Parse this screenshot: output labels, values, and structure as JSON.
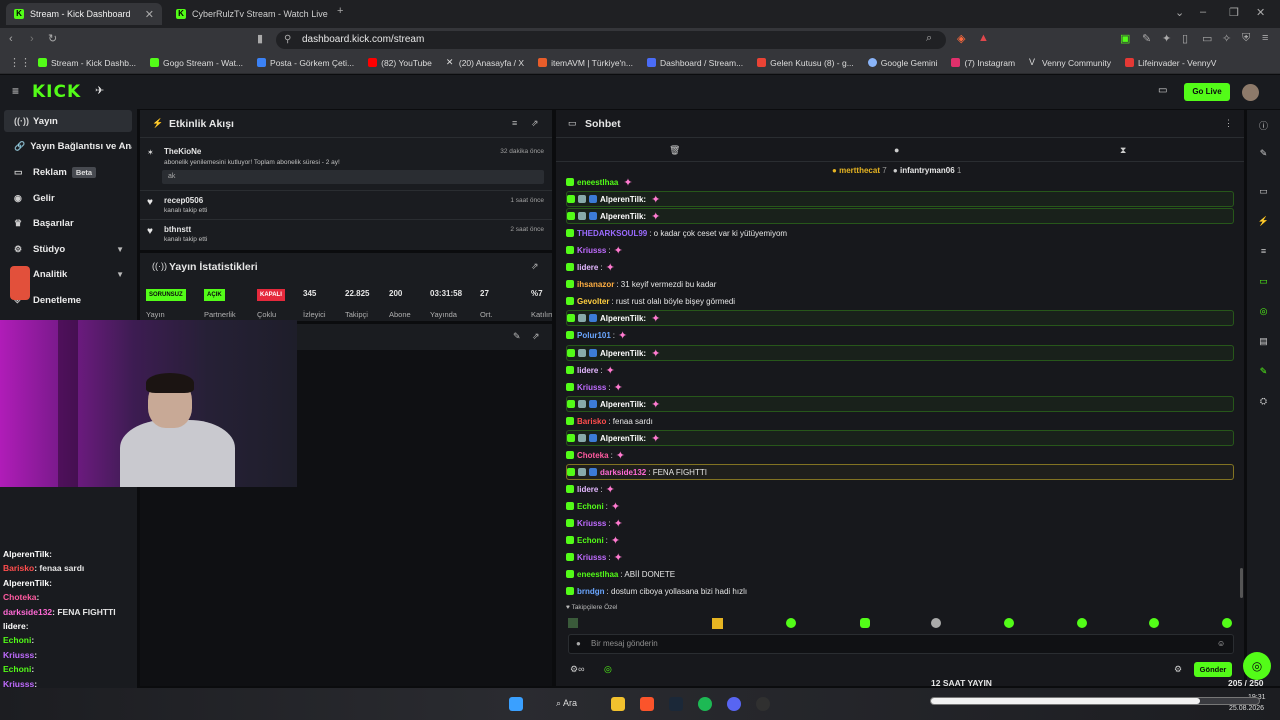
{
  "browser": {
    "tabs": [
      {
        "title": "Stream - Kick Dashboard"
      },
      {
        "title": "CyberRulzTv Stream - Watch Live on"
      }
    ],
    "new_tab": "+",
    "url": "dashboard.kick.com/stream",
    "bookmarks": [
      {
        "label": "Stream - Kick Dashb...",
        "color": "#53fc18"
      },
      {
        "label": "Gogo Stream - Wat...",
        "color": "#53fc18"
      },
      {
        "label": "Posta - Görkem Çeti...",
        "color": "#3b82f6"
      },
      {
        "label": "(82) YouTube",
        "color": "#ff0000"
      },
      {
        "label": "(20) Anasayfa / X",
        "color": "#dddddd"
      },
      {
        "label": "itemAVM | Türkiye'n...",
        "color": "#e85d2a"
      },
      {
        "label": "Dashboard / Stream...",
        "color": "#4a6cf7"
      },
      {
        "label": "Gelen Kutusu (8) - g...",
        "color": "#ea4335"
      },
      {
        "label": "Google Gemini",
        "color": "#8ab4f8"
      },
      {
        "label": "(7) Instagram",
        "color": "#e1306c"
      },
      {
        "label": "Venny Community",
        "color": "#dddddd"
      },
      {
        "label": "Lifeinvader - VennyV",
        "color": "#e53935"
      }
    ]
  },
  "kick": {
    "logo": "KICK",
    "go_live": "Go Live"
  },
  "sidebar": {
    "items": [
      {
        "label": "Yayın",
        "icon": "broadcast-icon"
      },
      {
        "label": "Yayın Bağlantısı ve Anahtarı",
        "icon": "link-icon"
      },
      {
        "label": "Reklam",
        "badge": "Beta",
        "icon": "ad-icon"
      },
      {
        "label": "Gelir",
        "icon": "revenue-icon"
      },
      {
        "label": "Başarılar",
        "icon": "trophy-icon"
      },
      {
        "label": "Stüdyo",
        "icon": "studio-icon"
      },
      {
        "label": "Analitik",
        "icon": "analytics-icon"
      },
      {
        "label": "Denetleme",
        "icon": "moderation-icon"
      }
    ]
  },
  "activity": {
    "title": "Etkinlik Akışı",
    "events": [
      {
        "name": "TheKioNe",
        "desc": "abonelik yenilemesini kutluyor! Toplam abonelik süresi - 2 ay!",
        "time": "32 dakika önce",
        "quote": "ak"
      },
      {
        "name": "recep0506",
        "desc": "kanalı takip etti",
        "time": "1 saat önce"
      },
      {
        "name": "bthnstt",
        "desc": "kanalı takip etti",
        "time": "2 saat önce"
      }
    ]
  },
  "stats": {
    "title": "Yayın İstatistikleri",
    "badges": [
      {
        "text": "SORUNSUZ",
        "label": "Yayın",
        "color": "#53fc18"
      },
      {
        "text": "AÇIK",
        "label": "Partnerlik",
        "color": "#53fc18"
      },
      {
        "text": "KAPALI",
        "label": "Çoklu",
        "color": "#e5293c"
      }
    ],
    "values": [
      {
        "value": "345",
        "label": "İzleyici"
      },
      {
        "value": "22.825",
        "label": "Takipçi"
      },
      {
        "value": "200",
        "label": "Abone Sayısı"
      },
      {
        "value": "03:31:58",
        "label": "Yayında Olduğu"
      },
      {
        "value": "27",
        "label": "Ort. Sohbet"
      },
      {
        "value": "%7",
        "label": "Katılım"
      }
    ]
  },
  "chat": {
    "title": "Sohbet",
    "pinned": [
      {
        "name": "mertthecat",
        "count": "7"
      },
      {
        "name": "infantryman06",
        "count": "1"
      }
    ],
    "messages": [
      {
        "user": "eneestlhaa",
        "text": "",
        "color": "#53fc18",
        "hl": false
      },
      {
        "user": "AlperenTilk:",
        "text": "",
        "color": "#ffffff",
        "hl": true
      },
      {
        "user": "AlperenTilk:",
        "text": "",
        "color": "#ffffff",
        "hl": true
      },
      {
        "user": "THEDARKSOUL99",
        "text": ": o kadar çok ceset var ki yütüyemiyom",
        "color": "#9b6bff",
        "hl": false
      },
      {
        "user": "Kriusss",
        "text": ":",
        "color": "#c06bff",
        "hl": false
      },
      {
        "user": "lidere",
        "text": ":",
        "color": "#e3b7ff",
        "hl": false
      },
      {
        "user": "ihsanazor",
        "text": ": 31 keyif vermezdi bu kadar",
        "color": "#ffae42",
        "hl": false
      },
      {
        "user": "Gevolter",
        "text": ": rust rust olalı böyle bişey görmedi",
        "color": "#ffcf40",
        "hl": false
      },
      {
        "user": "AlperenTilk:",
        "text": "",
        "color": "#ffffff",
        "hl": true
      },
      {
        "user": "Polur101",
        "text": ":",
        "color": "#6aa6ff",
        "hl": false
      },
      {
        "user": "AlperenTilk:",
        "text": "",
        "color": "#ffffff",
        "hl": true
      },
      {
        "user": "lidere",
        "text": ":",
        "color": "#e3b7ff",
        "hl": false
      },
      {
        "user": "Kriusss",
        "text": ":",
        "color": "#c06bff",
        "hl": false
      },
      {
        "user": "AlperenTilk:",
        "text": "",
        "color": "#ffffff",
        "hl": true
      },
      {
        "user": "Barisko",
        "text": ": fenaa sardı",
        "color": "#ff4d4d",
        "hl": false
      },
      {
        "user": "AlperenTilk:",
        "text": "",
        "color": "#ffffff",
        "hl": true
      },
      {
        "user": "Choteka",
        "text": ":",
        "color": "#ff5aa0",
        "hl": false
      },
      {
        "user": "darkside132",
        "text": ": FENA FIGHTTI",
        "color": "#ff6ad5",
        "hl": "y"
      },
      {
        "user": "lidere",
        "text": ":",
        "color": "#e3b7ff",
        "hl": false
      },
      {
        "user": "Echoni",
        "text": ":",
        "color": "#53fc18",
        "hl": false
      },
      {
        "user": "Kriusss",
        "text": ":",
        "color": "#c06bff",
        "hl": false
      },
      {
        "user": "Echoni",
        "text": ":",
        "color": "#53fc18",
        "hl": false
      },
      {
        "user": "Kriusss",
        "text": ":",
        "color": "#c06bff",
        "hl": false
      },
      {
        "user": "eneestlhaa",
        "text": ": ABİİ DONETE",
        "color": "#53fc18",
        "hl": false
      },
      {
        "user": "brndgn",
        "text": ": dostum ciboya yollasana bizi hadi hızlı",
        "color": "#6aa6ff",
        "hl": false
      }
    ],
    "followers_only": "Takipçilere Özel",
    "placeholder": "Bir mesaj gönderin",
    "send": "Gönder"
  },
  "overlay_chat": [
    {
      "user": "AlperenTilk",
      "text": ":",
      "color": "#ffffff"
    },
    {
      "user": "Barisko",
      "text": ": fenaa sardı",
      "color": "#ff4d4d"
    },
    {
      "user": "AlperenTilk",
      "text": ":",
      "color": "#ffffff"
    },
    {
      "user": "Choteka",
      "text": ":",
      "color": "#ff5aa0"
    },
    {
      "user": "darkside132",
      "text": ": FENA FIGHTTI",
      "color": "#ff6ad5"
    },
    {
      "user": "lidere",
      "text": ":",
      "color": "#ffffff"
    },
    {
      "user": "Echoni",
      "text": ":",
      "color": "#53fc18"
    },
    {
      "user": "Kriusss",
      "text": ":",
      "color": "#c06bff"
    },
    {
      "user": "Echoni",
      "text": ":",
      "color": "#53fc18"
    },
    {
      "user": "Kriusss",
      "text": ":",
      "color": "#c06bff"
    },
    {
      "user": "eneestlhaa",
      "text": ": ABİİ DONETE",
      "color": "#53fc18"
    },
    {
      "user": "brndgn",
      "text": ": dostum ciboya yollasana bizi hadi hızlı",
      "color": "#6aa6ff"
    }
  ],
  "progress": {
    "label": "12 SAAT YAYIN",
    "count": "205 / 250",
    "fraction": 0.82
  },
  "taskbar": {
    "search": "Ara",
    "time": "19:31",
    "date": "25.08.2026"
  }
}
